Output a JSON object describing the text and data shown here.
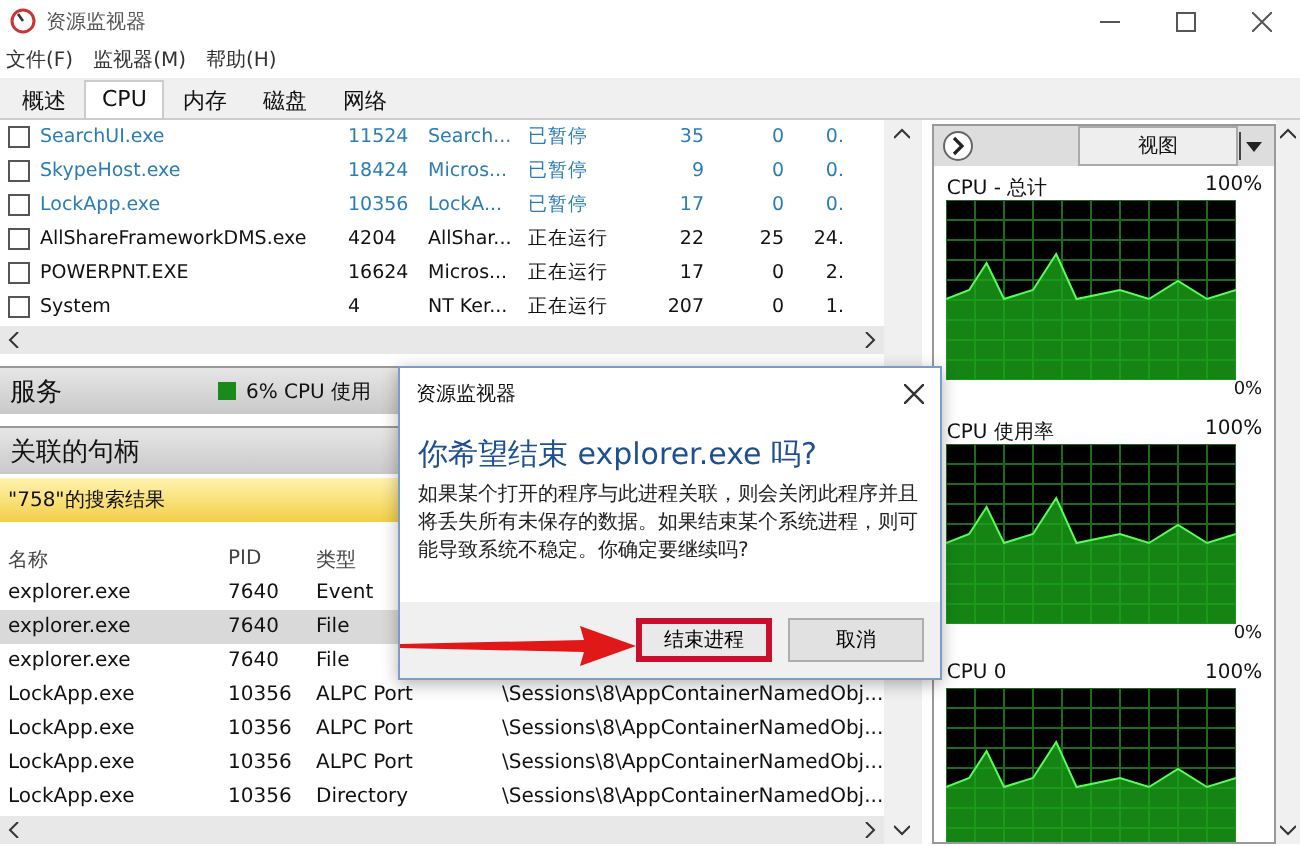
{
  "window": {
    "title": "资源监视器"
  },
  "menu": [
    "文件(F)",
    "监视器(M)",
    "帮助(H)"
  ],
  "tabs": [
    {
      "label": "概述",
      "selected": false
    },
    {
      "label": "CPU",
      "selected": true
    },
    {
      "label": "内存",
      "selected": false
    },
    {
      "label": "磁盘",
      "selected": false
    },
    {
      "label": "网络",
      "selected": false
    }
  ],
  "processes": [
    {
      "checked": false,
      "suspended": true,
      "cells": [
        "SearchUI.exe",
        "11524",
        "Search...",
        "已暂停",
        "35",
        "0",
        "0."
      ]
    },
    {
      "checked": false,
      "suspended": true,
      "cells": [
        "SkypeHost.exe",
        "18424",
        "Micros...",
        "已暂停",
        "9",
        "0",
        "0."
      ]
    },
    {
      "checked": false,
      "suspended": true,
      "cells": [
        "LockApp.exe",
        "10356",
        "LockA...",
        "已暂停",
        "17",
        "0",
        "0."
      ]
    },
    {
      "checked": false,
      "suspended": false,
      "cells": [
        "AllShareFrameworkDMS.exe",
        "4204",
        "AllShar...",
        "正在运行",
        "22",
        "25",
        "24."
      ]
    },
    {
      "checked": false,
      "suspended": false,
      "cells": [
        "POWERPNT.EXE",
        "16624",
        "Micros...",
        "正在运行",
        "17",
        "0",
        "2."
      ]
    },
    {
      "checked": false,
      "suspended": false,
      "cells": [
        "System",
        "4",
        "NT Ker...",
        "正在运行",
        "207",
        "0",
        "1."
      ]
    }
  ],
  "services": {
    "title": "服务",
    "usage": "6% CPU 使用"
  },
  "handles": {
    "title": "关联的句柄",
    "search_result": "\"758\"的搜索结果",
    "columns": [
      "名称",
      "PID",
      "类型"
    ],
    "rows": [
      {
        "selected": false,
        "cells": [
          "explorer.exe",
          "7640",
          "Event"
        ]
      },
      {
        "selected": true,
        "cells": [
          "explorer.exe",
          "7640",
          "File"
        ]
      },
      {
        "selected": false,
        "cells": [
          "explorer.exe",
          "7640",
          "File"
        ]
      },
      {
        "selected": false,
        "cells": [
          "LockApp.exe",
          "10356",
          "ALPC Port",
          "\\Sessions\\8\\AppContainerNamedObj..."
        ]
      },
      {
        "selected": false,
        "cells": [
          "LockApp.exe",
          "10356",
          "ALPC Port",
          "\\Sessions\\8\\AppContainerNamedObj..."
        ]
      },
      {
        "selected": false,
        "cells": [
          "LockApp.exe",
          "10356",
          "ALPC Port",
          "\\Sessions\\8\\AppContainerNamedObj..."
        ]
      },
      {
        "selected": false,
        "cells": [
          "LockApp.exe",
          "10356",
          "Directory",
          "\\Sessions\\8\\AppContainerNamedObj..."
        ]
      }
    ]
  },
  "right_panel": {
    "view_button": "视图",
    "graphs": [
      {
        "title": "CPU - 总计",
        "max": "100%",
        "min": "0%"
      },
      {
        "title": "CPU 使用率",
        "max": "100%",
        "min": "0%"
      },
      {
        "title": "CPU 0",
        "max": "100%"
      }
    ]
  },
  "dialog": {
    "title": "资源监视器",
    "heading": "你希望结束 explorer.exe 吗?",
    "message": "如果某个打开的程序与此进程关联，则会关闭此程序并且将丢失所有未保存的数据。如果结束某个系统进程，则可能导致系统不稳定。你确定要继续吗?",
    "buttons": [
      {
        "label": "结束进程",
        "highlighted": true
      },
      {
        "label": "取消",
        "highlighted": false
      }
    ]
  }
}
